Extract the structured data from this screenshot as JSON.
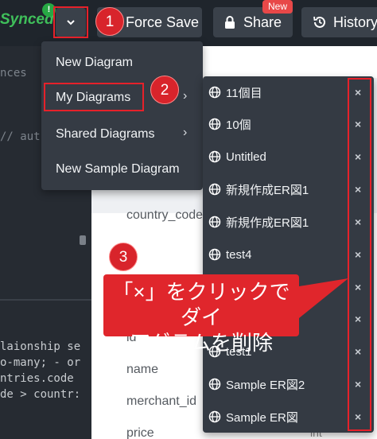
{
  "toolbar": {
    "synced_label": "Synced",
    "sync_badge": "!",
    "force_save_label": "Force Save",
    "share_label": "Share",
    "new_badge": "New",
    "history_label": "History"
  },
  "editor": {
    "lines": [
      "nces",
      "// aut",
      "laionship se",
      "o-many; - or",
      "ntries.code",
      "de > countr:"
    ]
  },
  "canvas": {
    "fields": [
      "country_code",
      "id",
      "name",
      "merchant_id",
      "price"
    ],
    "type_label": "int"
  },
  "menu": {
    "items": [
      {
        "label": "New Diagram"
      },
      {
        "label": "My Diagrams",
        "arrow": "›"
      },
      {
        "label": "Shared Diagrams",
        "arrow": "›"
      },
      {
        "label": "New Sample Diagram"
      }
    ]
  },
  "submenu": {
    "items": [
      {
        "label": "11個目",
        "close": "×"
      },
      {
        "label": "10個",
        "close": "×"
      },
      {
        "label": "Untitled",
        "close": "×"
      },
      {
        "label": "新規作成ER図1",
        "close": "×"
      },
      {
        "label": "新規作成ER図1",
        "close": "×"
      },
      {
        "label": "test4",
        "close": "×"
      },
      {
        "label": "",
        "close": "×"
      },
      {
        "label": "",
        "close": "×"
      },
      {
        "label": "test1",
        "close": "×"
      },
      {
        "label": "Sample ER図2",
        "close": "×"
      },
      {
        "label": "Sample ER図",
        "close": "×"
      }
    ]
  },
  "annotations": {
    "step1": "1",
    "step2": "2",
    "step3": "3",
    "callout_line1": "「×」をクリックでダイ",
    "callout_line2": "アグラムを削除"
  },
  "colors": {
    "accent_red": "#e6212a",
    "synced_green": "#3fbf5a",
    "toolbar_bg": "#1f252c",
    "menu_bg": "#353b44"
  }
}
